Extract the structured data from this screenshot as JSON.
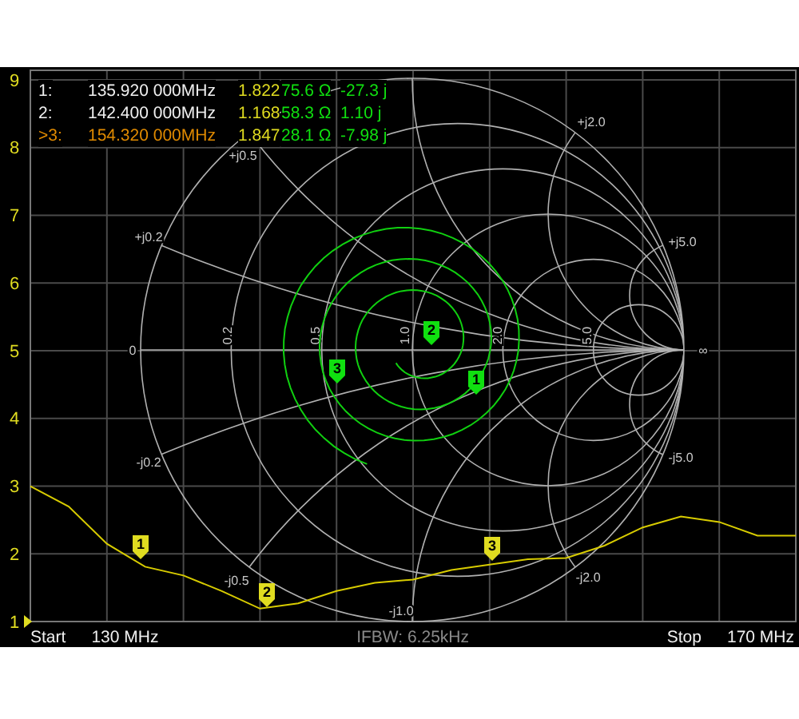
{
  "markers": [
    {
      "label": "1:",
      "flag": "1",
      "frequency": "135.920 000MHz",
      "swr": "1.822",
      "resistance": "75.6 Ω",
      "reactance": "-27.3 j",
      "selected": false
    },
    {
      "label": "2:",
      "flag": "2",
      "frequency": "142.400 000MHz",
      "swr": "1.168",
      "resistance": "58.3 Ω",
      "reactance": "1.10 j",
      "selected": false
    },
    {
      "label": ">3:",
      "flag": "3",
      "frequency": "154.320 000MHz",
      "swr": "1.847",
      "resistance": "28.1 Ω",
      "reactance": "-7.98 j",
      "selected": true
    }
  ],
  "swr_chart": {
    "chart_data": {
      "type": "line",
      "grid": true,
      "ylim": [
        1,
        9
      ],
      "yticks": [
        1,
        2,
        3,
        4,
        5,
        6,
        7,
        8,
        9
      ],
      "categories": [
        null,
        null,
        null,
        null,
        null,
        null,
        null,
        null,
        null,
        null,
        null,
        null,
        null,
        null,
        null,
        null,
        null,
        null,
        null,
        null,
        null
      ],
      "series": [
        {
          "color": "#d8cc00",
          "values": [
            3.0,
            2.7,
            2.15,
            1.81,
            1.68,
            1.45,
            1.19,
            1.27,
            1.45,
            1.57,
            1.62,
            1.76,
            1.84,
            1.92,
            1.94,
            2.12,
            2.39,
            2.55,
            2.47,
            2.27,
            2.27
          ]
        }
      ]
    }
  },
  "smith_chart": {
    "labels": [
      {
        "text": "0"
      },
      {
        "text": "0.2"
      },
      {
        "text": "0.5"
      },
      {
        "text": "1.0"
      },
      {
        "text": "2.0"
      },
      {
        "text": "5.0"
      },
      {
        "text": "∞"
      },
      {
        "text": "+j0.2"
      },
      {
        "text": "+j0.5"
      },
      {
        "text": "+j2.0"
      },
      {
        "text": "+j5.0"
      },
      {
        "text": "-j0.2"
      },
      {
        "text": "-j0.5"
      },
      {
        "text": "-j1.0"
      },
      {
        "text": "-j2.0"
      },
      {
        "text": "-j5.0"
      }
    ],
    "marker_flags": [
      {
        "text": "1"
      },
      {
        "text": "2"
      },
      {
        "text": "3"
      }
    ]
  },
  "footer": {
    "start_label": "Start",
    "start_value": "130 MHz",
    "ifbw": "IFBW: 6.25kHz",
    "stop_label": "Stop",
    "stop_value": "170 MHz"
  }
}
